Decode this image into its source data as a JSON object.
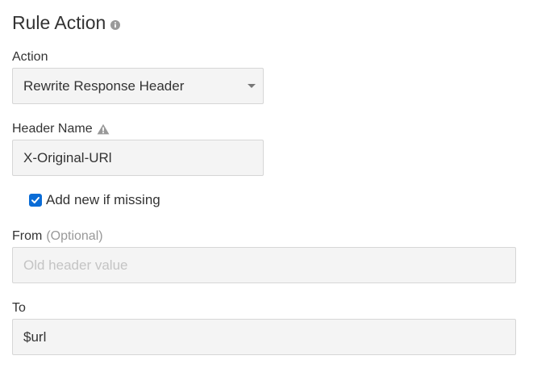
{
  "panel": {
    "title": "Rule Action",
    "title_icon": "info-circle-icon"
  },
  "action": {
    "label": "Action",
    "selected": "Rewrite Response Header",
    "icon": "caret-down-icon"
  },
  "header_name": {
    "label": "Header Name",
    "icon": "warning-triangle-icon",
    "value": "X-Original-URl"
  },
  "add_if_missing": {
    "label": "Add new if missing",
    "checked": true
  },
  "from": {
    "label": "From",
    "optional_note": "(Optional)",
    "value": "",
    "placeholder": "Old header value"
  },
  "to": {
    "label": "To",
    "value": "$url"
  },
  "colors": {
    "checkbox_accent": "#0a6cd6",
    "field_background": "#f4f4f4",
    "field_border": "#d6d6d6",
    "muted_text": "#999999"
  }
}
